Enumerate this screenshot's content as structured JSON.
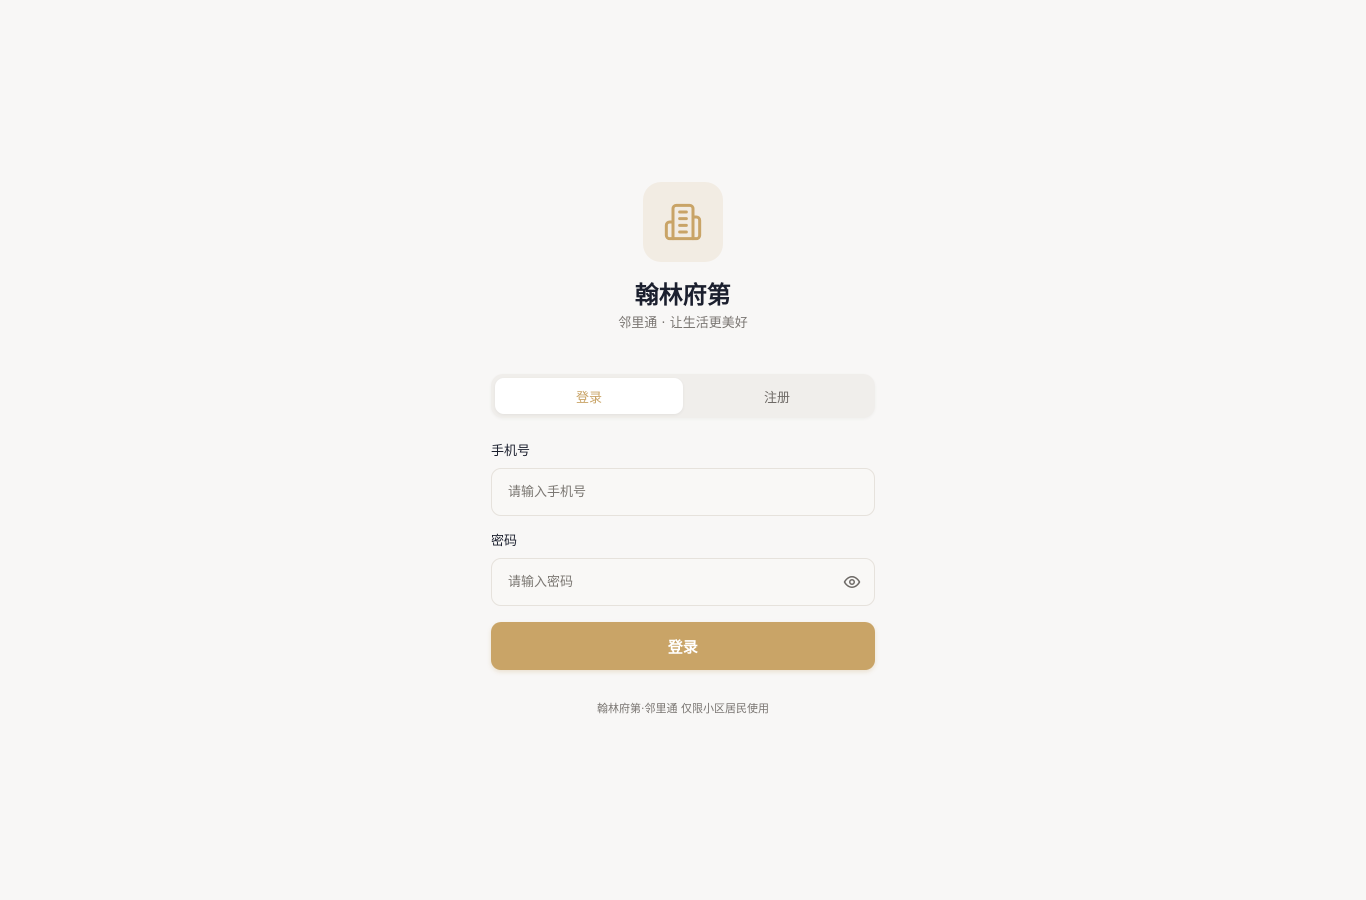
{
  "brand": {
    "logo_icon": "building-icon",
    "title": "翰林府第",
    "subtitle": "邻里通 · 让生活更美好"
  },
  "tabs": [
    {
      "label": "登录",
      "active": true
    },
    {
      "label": "注册",
      "active": false
    }
  ],
  "form": {
    "phone_label": "手机号",
    "phone_placeholder": "请输入手机号",
    "phone_value": "",
    "password_label": "密码",
    "password_placeholder": "请输入密码",
    "password_value": "",
    "password_toggle_icon": "eye-icon",
    "submit_label": "登录"
  },
  "footer": {
    "text": "翰林府第·邻里通 仅限小区居民使用"
  },
  "colors": {
    "accent": "#c9a467",
    "background": "#f8f7f6",
    "title": "#1b1f2e",
    "logo_bg": "#f2ece3"
  }
}
